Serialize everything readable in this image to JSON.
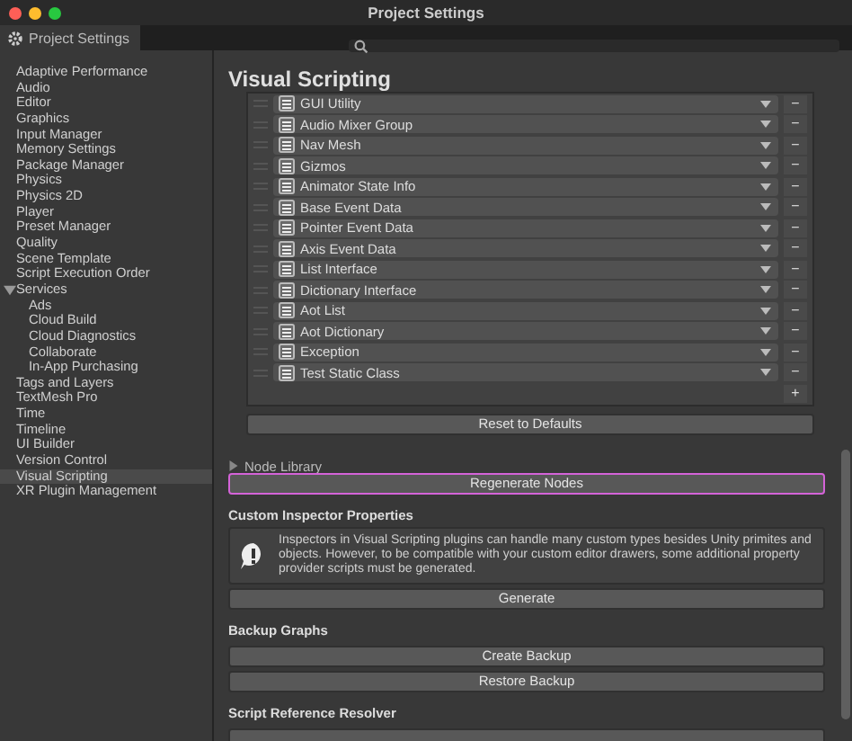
{
  "window": {
    "title": "Project Settings"
  },
  "tab": {
    "label": "Project Settings",
    "selected": true
  },
  "sidebar": {
    "items": [
      {
        "label": "Adaptive Performance",
        "selected": false
      },
      {
        "label": "Audio",
        "selected": false
      },
      {
        "label": "Editor",
        "selected": false
      },
      {
        "label": "Graphics",
        "selected": false
      },
      {
        "label": "Input Manager",
        "selected": false
      },
      {
        "label": "Memory Settings",
        "selected": false
      },
      {
        "label": "Package Manager",
        "selected": false
      },
      {
        "label": "Physics",
        "selected": false
      },
      {
        "label": "Physics 2D",
        "selected": false
      },
      {
        "label": "Player",
        "selected": false
      },
      {
        "label": "Preset Manager",
        "selected": false
      },
      {
        "label": "Quality",
        "selected": false
      },
      {
        "label": "Scene Template",
        "selected": false
      },
      {
        "label": "Script Execution Order",
        "selected": false
      },
      {
        "label": "Services",
        "selected": false,
        "expanded": true,
        "children": [
          {
            "label": "Ads",
            "selected": false
          },
          {
            "label": "Cloud Build",
            "selected": false
          },
          {
            "label": "Cloud Diagnostics",
            "selected": false
          },
          {
            "label": "Collaborate",
            "selected": false
          },
          {
            "label": "In-App Purchasing",
            "selected": false
          }
        ]
      },
      {
        "label": "Tags and Layers",
        "selected": false
      },
      {
        "label": "TextMesh Pro",
        "selected": false
      },
      {
        "label": "Time",
        "selected": false
      },
      {
        "label": "Timeline",
        "selected": false
      },
      {
        "label": "UI Builder",
        "selected": false
      },
      {
        "label": "Version Control",
        "selected": false
      },
      {
        "label": "Visual Scripting",
        "selected": true
      },
      {
        "label": "XR Plugin Management",
        "selected": false
      }
    ]
  },
  "panel": {
    "title": "Visual Scripting",
    "type_options": [
      {
        "label": "GUI Utility"
      },
      {
        "label": "Audio Mixer Group"
      },
      {
        "label": "Nav Mesh"
      },
      {
        "label": "Gizmos"
      },
      {
        "label": "Animator State Info"
      },
      {
        "label": "Base Event Data"
      },
      {
        "label": "Pointer Event Data"
      },
      {
        "label": "Axis Event Data"
      },
      {
        "label": "List Interface"
      },
      {
        "label": "Dictionary Interface"
      },
      {
        "label": "Aot List"
      },
      {
        "label": "Aot Dictionary"
      },
      {
        "label": "Exception"
      },
      {
        "label": "Test Static Class"
      }
    ],
    "add_button": "+",
    "remove_button": "−",
    "reset_button": "Reset to Defaults",
    "node_library": {
      "label": "Node Library",
      "expanded": false
    },
    "regenerate_button": {
      "label": "Regenerate Nodes",
      "focused": true
    },
    "sections": [
      {
        "heading": "Custom Inspector Properties",
        "help": "Inspectors in Visual Scripting plugins can handle many custom types besides Unity primites and objects. However, to be compatible with your custom editor drawers, some additional property provider scripts must be generated.",
        "buttons": [
          "Generate"
        ]
      },
      {
        "heading": "Backup Graphs",
        "buttons": [
          "Create Backup",
          "Restore Backup"
        ]
      },
      {
        "heading": "Script Reference Resolver",
        "partial_button": true
      }
    ]
  }
}
